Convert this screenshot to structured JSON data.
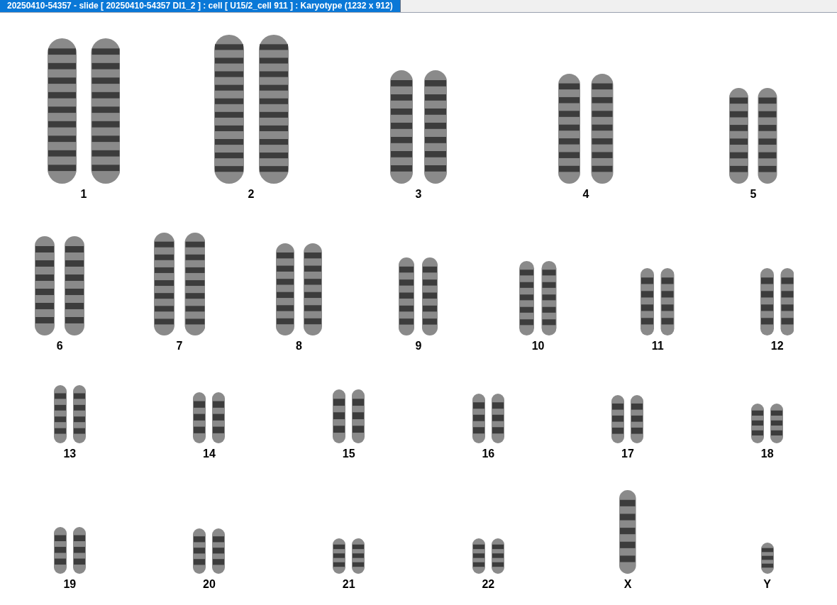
{
  "window": {
    "title": "20250410-54357 - slide [ 20250410-54357 DI1_2 ] : cell [ U15/2_cell 911 ] : Karyotype  (1232 x 912)"
  },
  "rows": [
    {
      "items": [
        {
          "label": "1"
        },
        {
          "label": "2"
        },
        {
          "label": "3"
        },
        {
          "label": "4"
        },
        {
          "label": "5"
        }
      ]
    },
    {
      "items": [
        {
          "label": "6"
        },
        {
          "label": "7"
        },
        {
          "label": "8"
        },
        {
          "label": "9"
        },
        {
          "label": "10"
        },
        {
          "label": "11"
        },
        {
          "label": "12"
        }
      ]
    },
    {
      "items": [
        {
          "label": "13"
        },
        {
          "label": "14"
        },
        {
          "label": "15"
        },
        {
          "label": "16"
        },
        {
          "label": "17"
        },
        {
          "label": "18"
        }
      ]
    },
    {
      "items": [
        {
          "label": "19"
        },
        {
          "label": "20"
        },
        {
          "label": "21"
        },
        {
          "label": "22"
        },
        {
          "label": "X"
        },
        {
          "label": "Y"
        }
      ]
    }
  ]
}
